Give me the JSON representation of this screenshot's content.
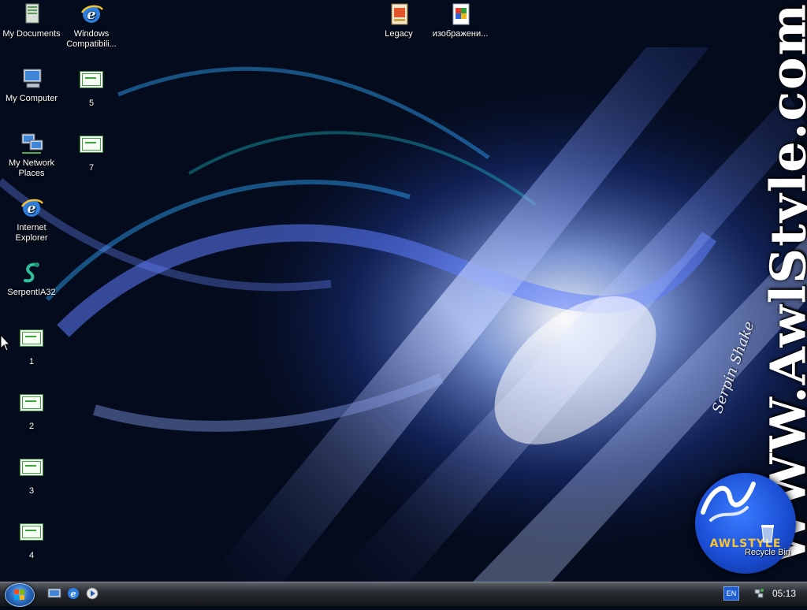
{
  "desktop": {
    "icons": [
      {
        "label": "My Documents",
        "icon": "my-documents-icon"
      },
      {
        "label": "Windows Compatibili...",
        "icon": "ie-shortcut-icon"
      },
      {
        "label": "Legacy",
        "icon": "legacy-app-icon"
      },
      {
        "label": "изображени...",
        "icon": "image-file-icon"
      },
      {
        "label": "My Computer",
        "icon": "my-computer-icon"
      },
      {
        "label": "5",
        "icon": "certificate-icon"
      },
      {
        "label": "My Network Places",
        "icon": "network-places-icon"
      },
      {
        "label": "7",
        "icon": "certificate-icon"
      },
      {
        "label": "Internet Explorer",
        "icon": "internet-explorer-icon"
      },
      {
        "label": "SerpentIA32",
        "icon": "serpent-icon"
      },
      {
        "label": "1",
        "icon": "certificate-icon"
      },
      {
        "label": "2",
        "icon": "certificate-icon"
      },
      {
        "label": "3",
        "icon": "certificate-icon"
      },
      {
        "label": "4",
        "icon": "certificate-icon"
      },
      {
        "label": "Recycle Bin",
        "icon": "recycle-bin-icon"
      }
    ]
  },
  "wallpaper": {
    "watermark": "WWW.AwlStyle.com",
    "subtext": "Serpin Shake",
    "badge_text": "AWLSTYLE"
  },
  "taskbar": {
    "language": "EN",
    "clock": "05:13",
    "quick_launch": [
      "show-desktop-icon",
      "internet-explorer-icon",
      "media-player-icon"
    ]
  },
  "colors": {
    "taskbar": "#2a2d33",
    "accent_blue": "#3a7cff",
    "cert_green": "#3aa53a"
  }
}
